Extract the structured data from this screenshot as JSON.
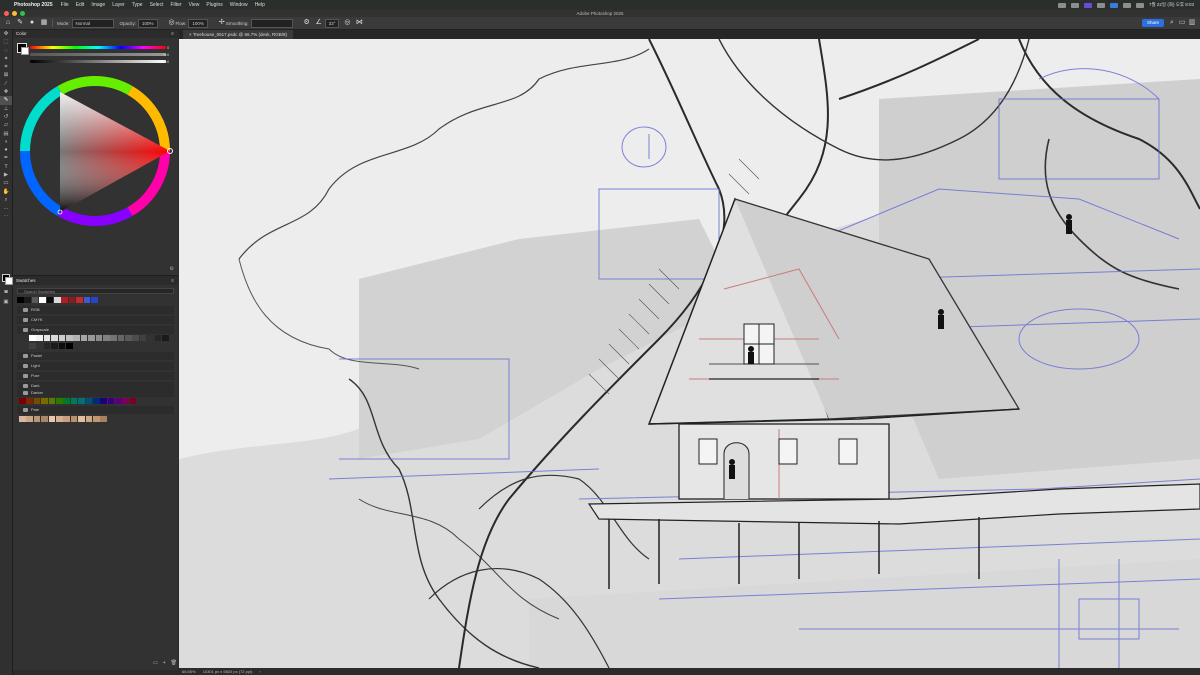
{
  "menubar": {
    "app_name": "Photoshop 2025",
    "menus": [
      "File",
      "Edit",
      "Image",
      "Layer",
      "Type",
      "Select",
      "Filter",
      "View",
      "Plugins",
      "Window",
      "Help"
    ],
    "clock": "7월 22일 (화) 오후 8:03"
  },
  "window": {
    "title": "Adobe Photoshop 2025"
  },
  "options": {
    "mode_label": "Mode:",
    "mode_value": "Normal",
    "opacity_label": "Opacity:",
    "opacity_value": "100%",
    "flow_label": "Flow:",
    "flow_value": "100%",
    "smoothing_label": "Smoothing:",
    "angle_value": "33°",
    "share_label": "Share"
  },
  "color_panel": {
    "tab_label": "Color",
    "hue_value": "0",
    "sat_value": "0",
    "bright_value": "0",
    "unit": "%"
  },
  "swatches_panel": {
    "tab_label": "Swatches",
    "search_placeholder": "Search Swatches",
    "folders": [
      "RGB",
      "CMYK",
      "Grayscale",
      "Pastel",
      "Light",
      "Pure",
      "Dark",
      "Darker",
      "Pale"
    ],
    "recent_colors": [
      "#000000",
      "#1a1a1a",
      "#5a5a5a",
      "#ffffff",
      "#0a0a0a",
      "#d9d9d9",
      "#b01e23",
      "#8f1a1e",
      "#c42a2a",
      "#3b5bd6",
      "#2743c7"
    ],
    "grayscale_colors": [
      "#ffffff",
      "#f2f2f2",
      "#e6e6e6",
      "#d9d9d9",
      "#cccccc",
      "#bfbfbf",
      "#b3b3b3",
      "#a6a6a6",
      "#999999",
      "#8c8c8c",
      "#808080",
      "#737373",
      "#666666",
      "#595959",
      "#4d4d4d",
      "#404040",
      "#333333",
      "#262626",
      "#1a1a1a",
      "#0d0d0d",
      "#000000"
    ],
    "darker_colors": [
      "#7a0000",
      "#7a2a00",
      "#7a4a00",
      "#7a6a00",
      "#5a7a00",
      "#2a7a00",
      "#007a2a",
      "#007a5a",
      "#00707a",
      "#00507a",
      "#002a7a",
      "#1a007a",
      "#3a007a",
      "#5a007a",
      "#7a005a",
      "#7a002a"
    ],
    "pale_colors": [
      "#d9b8a0",
      "#c9a88a",
      "#b89878",
      "#a88868",
      "#e8c8b0",
      "#d8b090",
      "#c8a080",
      "#b8906a",
      "#e0c0a0",
      "#cfa880",
      "#bf9870",
      "#a98060"
    ]
  },
  "document": {
    "tab_label": "Treehouse_0517.psdc @ 66.7% (desk, RGB/8)"
  },
  "status": {
    "zoom": "66.65%",
    "dimensions": "10301 px x 5820 px (72 ppi)"
  },
  "accent_colors": {
    "share": "#2c6fe0",
    "sketch_blue": "#6a6fd6",
    "sketch_red": "#c97b7b"
  }
}
